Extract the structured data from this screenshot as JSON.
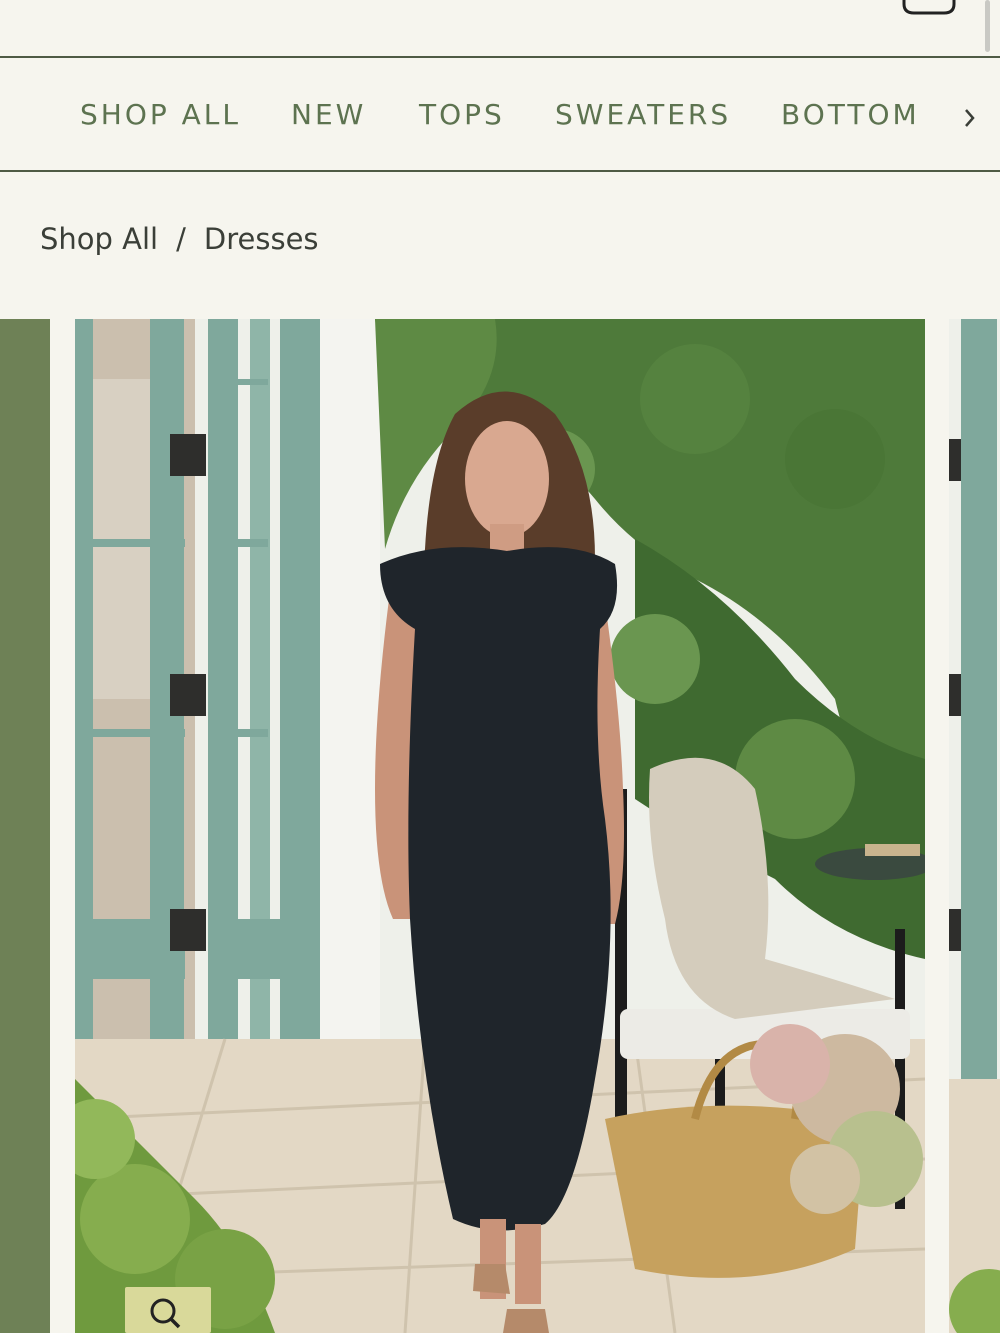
{
  "header": {
    "account_icon": "user-icon",
    "cart_icon": "shopping-bag-icon"
  },
  "nav": {
    "items": [
      {
        "label": "SHOP ALL"
      },
      {
        "label": "NEW"
      },
      {
        "label": "TOPS"
      },
      {
        "label": "SWEATERS"
      },
      {
        "label": "BOTTOM"
      }
    ],
    "next_icon": "chevron-right-icon"
  },
  "breadcrumb": {
    "parent": "Shop All",
    "separator": "/",
    "current": "Dresses"
  },
  "gallery": {
    "image_alt": "Model wearing black sleeveless midi dress in a garden courtyard",
    "zoom_icon": "magnifier-icon"
  },
  "colors": {
    "background": "#f6f5ee",
    "nav_text": "#5d7350",
    "rule": "#4f5b44",
    "prev_slide": "#6e8156",
    "zoom_button": "#d9d99a"
  }
}
